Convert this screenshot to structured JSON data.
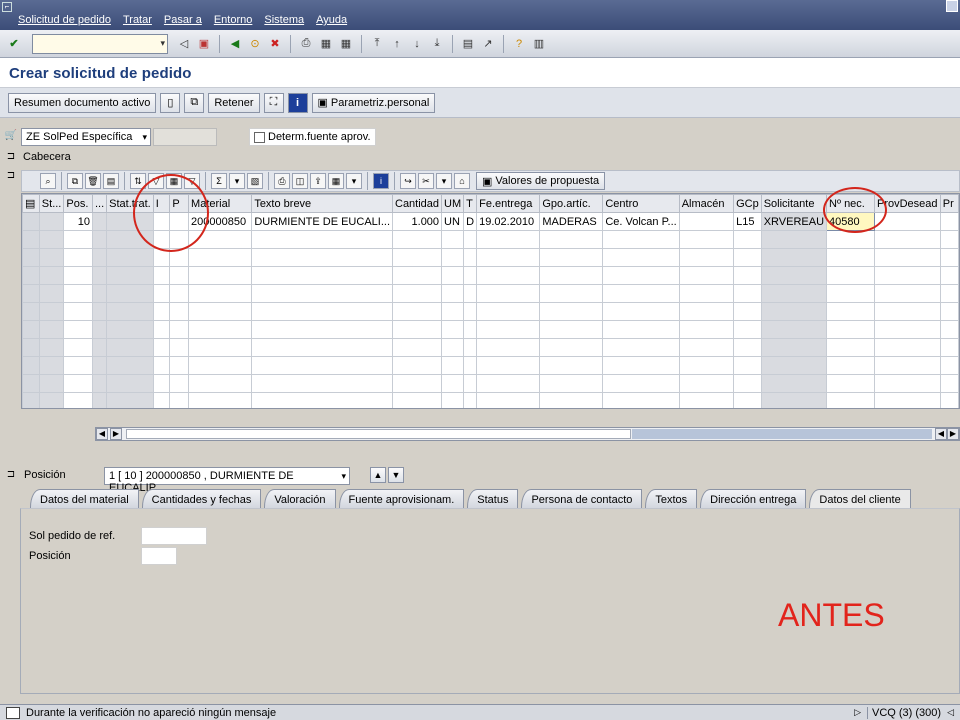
{
  "menu": [
    "Solicitud de pedido",
    "Tratar",
    "Pasar a",
    "Entorno",
    "Sistema",
    "Ayuda"
  ],
  "title": "Crear solicitud de pedido",
  "app_toolbar": {
    "summary_btn": "Resumen documento activo",
    "hold_btn": "Retener",
    "personal_btn": "Parametriz.personal"
  },
  "header": {
    "doc_type": "ZE SolPed Específica",
    "source_checkbox": "Determ.fuente aprov.",
    "cabecera": "Cabecera"
  },
  "grid_toolbar": {
    "proposal_btn": "Valores de propuesta"
  },
  "grid": {
    "columns": [
      "St...",
      "Pos.",
      "...",
      "Stat.trat.",
      "I",
      "P",
      "Material",
      "Texto breve",
      "Cantidad",
      "UM",
      "T",
      "Fe.entrega",
      "Gpo.artíc.",
      "Centro",
      "Almacén",
      "GCp",
      "Solicitante",
      "Nº nec.",
      "ProvDesead",
      "Pr"
    ],
    "row": [
      "",
      "10",
      "",
      "",
      "",
      "",
      "200000850",
      "DURMIENTE DE EUCALI...",
      "1.000",
      "UN",
      "D",
      "19.02.2010",
      "MADERAS",
      "Ce. Volcan P...",
      "",
      "L15",
      "XRVEREAU",
      "40580",
      "",
      ""
    ],
    "empty_rows": 11
  },
  "position": {
    "label": "Posición",
    "value": "1 [ 10 ] 200000850 , DURMIENTE DE EUCALIP..."
  },
  "tabs": [
    "Datos del material",
    "Cantidades y fechas",
    "Valoración",
    "Fuente aprovisionam.",
    "Status",
    "Persona de contacto",
    "Textos",
    "Dirección entrega",
    "Datos del cliente"
  ],
  "active_tab": "Datos del cliente",
  "fields": {
    "ref_order": "Sol pedido de ref.",
    "position": "Posición"
  },
  "annotation": "ANTES",
  "status": {
    "message": "Durante la verificación no apareció ningún mensaje",
    "system": "VCQ (3) (300)"
  }
}
